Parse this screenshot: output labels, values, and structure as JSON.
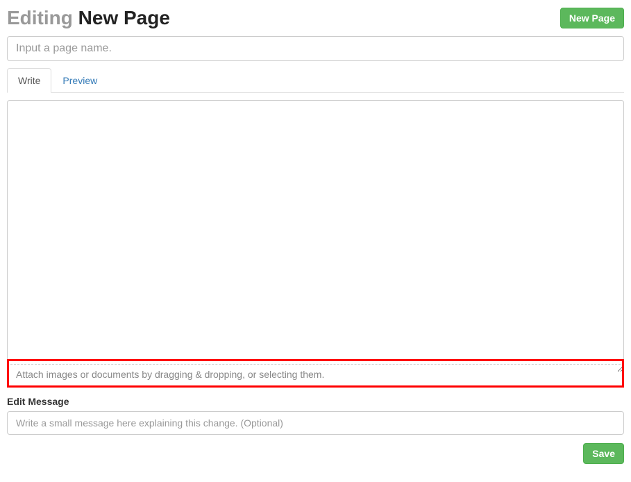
{
  "header": {
    "title_prefix": "Editing",
    "title_name": "New Page",
    "new_page_button": "New Page"
  },
  "page_name_input": {
    "placeholder": "Input a page name.",
    "value": ""
  },
  "tabs": {
    "write": "Write",
    "preview": "Preview"
  },
  "editor": {
    "value": ""
  },
  "attach": {
    "hint": "Attach images or documents by dragging & dropping, or selecting them."
  },
  "edit_message": {
    "label": "Edit Message",
    "placeholder": "Write a small message here explaining this change. (Optional)",
    "value": ""
  },
  "footer": {
    "save_button": "Save"
  }
}
